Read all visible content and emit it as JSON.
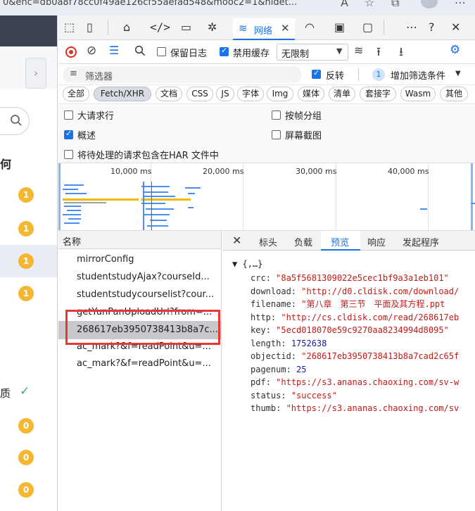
{
  "browser": {
    "url_fragment": "0&enc=db0a8f78cc0f49ae126cf55aefad548&mooc2=1&hidet..."
  },
  "left_page": {
    "heading": "何",
    "badges_orange": [
      "1",
      "1",
      "1",
      "1"
    ],
    "completed_label": "质",
    "badges_pending": [
      "0",
      "0",
      "0"
    ]
  },
  "devtools": {
    "tabs": {
      "network_label": "网络"
    },
    "toolbar": {
      "preserve_log_label": "保留日志",
      "preserve_log_checked": false,
      "disable_cache_label": "禁用缓存",
      "disable_cache_checked": true,
      "throttle_value": "无限制"
    },
    "filter": {
      "placeholder": "筛选器",
      "invert_label": "反转",
      "invert_checked": true,
      "more_filters_count": "1",
      "more_filters_label": "增加筛选条件"
    },
    "type_filters": [
      "全部",
      "Fetch/XHR",
      "文档",
      "CSS",
      "JS",
      "字体",
      "Img",
      "媒体",
      "清单",
      "套接字",
      "Wasm",
      "其他"
    ],
    "type_selected": "Fetch/XHR",
    "options": {
      "big_rows": "大请求行",
      "group_by_frame": "按帧分组",
      "overview": "概述",
      "screenshots": "屏幕截图",
      "har_include": "将待处理的请求包含在HAR 文件中"
    },
    "timeline_ticks": [
      "10,000 ms",
      "20,000 ms",
      "30,000 ms",
      "40,000 ms"
    ],
    "name_header": "名称",
    "requests": [
      "mirrorConfig",
      "studentstudyAjax?courseId...",
      "studentstudycourselist?cour...",
      "getYunPanUploadUrl?from=...",
      "268617eb3950738413b8a7c...",
      "ac_mark?&f=readPoint&u=...",
      "ac_mark?&f=readPoint&u=..."
    ],
    "selected_request_index": 4,
    "detail_tabs": [
      "标头",
      "负载",
      "预览",
      "响应",
      "发起程序"
    ],
    "active_detail_tab": "预览",
    "json_root": "{,…}",
    "json_fields": [
      {
        "key": "crc",
        "value": "\"8a5f5681309022e5cec1bf9a3a1eb101\"",
        "kind": "string"
      },
      {
        "key": "download",
        "value": "\"http://d0.cldisk.com/download/",
        "kind": "string"
      },
      {
        "key": "filename",
        "value": "\"第八章　第三节　平面及其方程.ppt",
        "kind": "string"
      },
      {
        "key": "http",
        "value": "\"http://cs.cldisk.com/read/268617eb",
        "kind": "string"
      },
      {
        "key": "key",
        "value": "\"5ecd018070e59c9270aa8234994d8095\"",
        "kind": "string"
      },
      {
        "key": "length",
        "value": "1752638",
        "kind": "number"
      },
      {
        "key": "objectid",
        "value": "\"268617eb3950738413b8a7cad2c65f",
        "kind": "string"
      },
      {
        "key": "pagenum",
        "value": "25",
        "kind": "number"
      },
      {
        "key": "pdf",
        "value": "\"https://s3.ananas.chaoxing.com/sv-w",
        "kind": "string"
      },
      {
        "key": "status",
        "value": "\"success\"",
        "kind": "string"
      },
      {
        "key": "thumb",
        "value": "\"https://s3.ananas.chaoxing.com/sv",
        "kind": "string"
      }
    ]
  }
}
